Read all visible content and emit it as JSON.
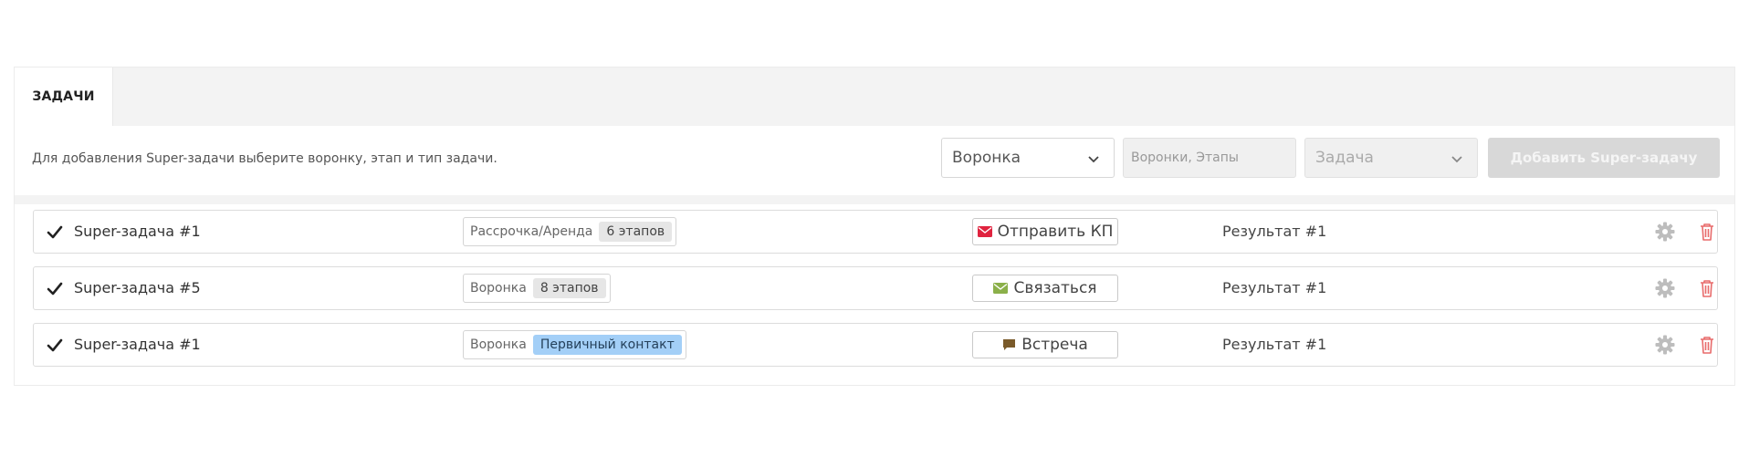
{
  "tabs": [
    {
      "label": "ЗАДАЧИ",
      "active": true
    }
  ],
  "toolbar": {
    "hint": "Для добавления Super-задачи выберите воронку, этап и тип задачи.",
    "funnel_select": {
      "value": "Воронка"
    },
    "stages_input": {
      "placeholder": "Воронки, Этапы"
    },
    "task_select": {
      "value": "Задача"
    },
    "add_button": {
      "label": "Добавить Super-задачу",
      "disabled": true
    }
  },
  "colors": {
    "accent_red": "#e0233f",
    "accent_green": "#8bb04a",
    "accent_brown": "#7a5a2a",
    "badge_blue": "#a3cff7",
    "trash_red": "#e86b6b"
  },
  "tasks": [
    {
      "checked": true,
      "name": "Super-задача #1",
      "funnel": "Рассрочка/Аренда",
      "stage": "6 этапов",
      "stage_style": "gray",
      "action": {
        "label": "Отправить КП",
        "icon": "envelope-icon",
        "color": "#e0233f"
      },
      "result": "Результат #1"
    },
    {
      "checked": true,
      "name": "Super-задача #5",
      "funnel": "Воронка",
      "stage": "8 этапов",
      "stage_style": "gray",
      "action": {
        "label": "Связаться",
        "icon": "envelope-icon",
        "color": "#8bb04a"
      },
      "result": "Результат #1"
    },
    {
      "checked": true,
      "name": "Super-задача #1",
      "funnel": "Воронка",
      "stage": "Первичный контакт",
      "stage_style": "blue",
      "action": {
        "label": "Встреча",
        "icon": "chat-bubble-icon",
        "color": "#7a5a2a"
      },
      "result": "Результат #1"
    }
  ]
}
